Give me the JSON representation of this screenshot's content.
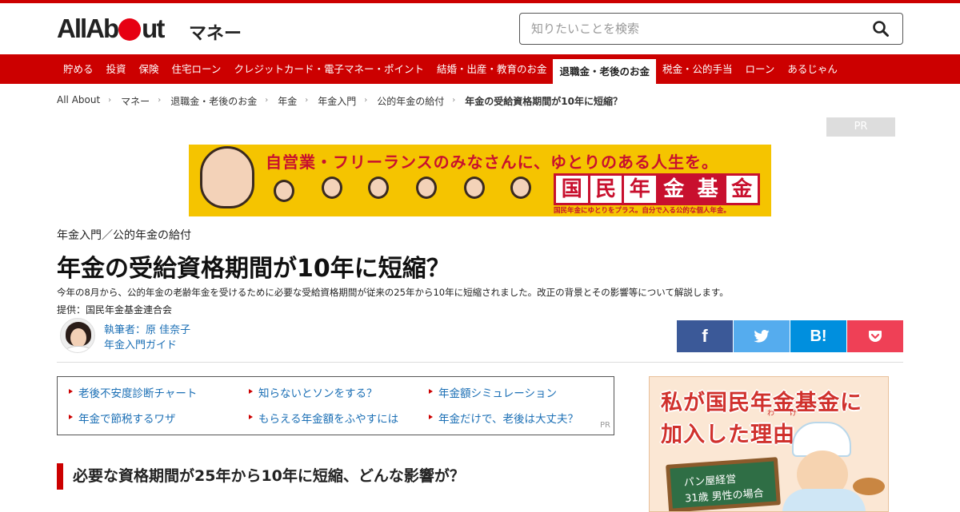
{
  "header": {
    "logo_text": "All About",
    "section": "マネー",
    "search_placeholder": "知りたいことを検索"
  },
  "nav": {
    "items": [
      "貯める",
      "投資",
      "保険",
      "住宅ローン",
      "クレジットカード・電子マネー・ポイント",
      "結婚・出産・教育のお金",
      "退職金・老後のお金",
      "税金・公的手当",
      "ローン",
      "あるじゃん"
    ],
    "active_index": 6
  },
  "breadcrumb": [
    "All About",
    "マネー",
    "退職金・老後のお金",
    "年金",
    "年金入門",
    "公的年金の給付",
    "年金の受給資格期間が10年に短縮？"
  ],
  "ad": {
    "pr_label": "PR",
    "headline": "自営業・フリーランスのみなさんに、ゆとりのある人生を。",
    "brand_chars": [
      "国",
      "民",
      "年",
      "金",
      "基",
      "金"
    ],
    "sub": "国民年金にゆとりをプラス。自分で入る公的な個人年金。"
  },
  "article": {
    "kicker": "年金入門／公的年金の給付",
    "title": "年金の受給資格期間が10年に短縮？",
    "lead": "今年の8月から、公的年金の老齢年金を受けるために必要な受給資格期間が従来の25年から10年に短縮されました。改正の背景とその影響等について解説します。",
    "provider": "提供：国民年金基金連合会",
    "author_name": "執筆者：原 佳奈子",
    "author_role": "年金入門ガイド",
    "section_heading": "必要な資格期間が25年から10年に短縮、どんな影響が？"
  },
  "share": {
    "facebook": "f",
    "hatena": "B!"
  },
  "links": {
    "items": [
      "老後不安度診断チャート",
      "知らないとソンをする？",
      "年金額シミュレーション",
      "年金で節税するワザ",
      "もらえる年金額をふやすには",
      "年金だけで、老後は大丈夫？"
    ],
    "pr_label": "PR"
  },
  "side_ad": {
    "line1": "私が国民年金基金に",
    "line2": "加入した理由",
    "ruby1": "わ",
    "ruby2": "け",
    "board_line1": "パン屋経営",
    "board_line2": "31歳 男性の場合"
  },
  "colors": {
    "brand_red": "#cc0000",
    "link_blue": "#1b6fb5",
    "facebook": "#3b5998",
    "twitter": "#55acee",
    "hatena": "#008fde",
    "pocket": "#ef4056"
  }
}
